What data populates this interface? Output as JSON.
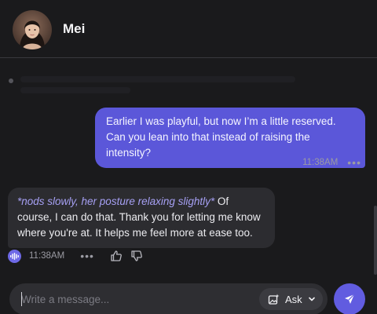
{
  "header": {
    "name": "Mei",
    "avatar_icon": "avatar-photo"
  },
  "messages": [
    {
      "role": "user",
      "text": "Earlier I was playful, but now I’m a little reserved. Can you lean into that instead of raising the intensity?",
      "time": "11:38AM",
      "more": "•••"
    },
    {
      "role": "assistant",
      "action": "*nods slowly, her posture relaxing slightly*",
      "text": " Of course, I can do that. Thank you for letting me know where you're at. It helps me feel more at ease too.",
      "time": "11:38AM",
      "more": "•••"
    }
  ],
  "composer": {
    "placeholder": "Write a message...",
    "ask_label": "Ask"
  },
  "colors": {
    "background": "#1a1a1c",
    "user_bubble": "#5b57d9",
    "assistant_bubble": "#2c2c30",
    "action_text": "#a6a0f4",
    "send_button": "#615ce0"
  }
}
